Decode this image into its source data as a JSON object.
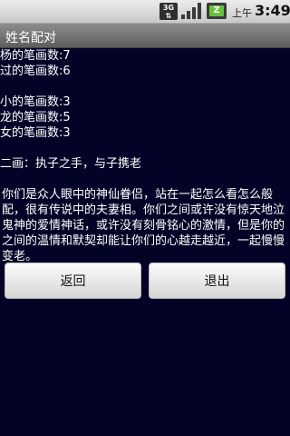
{
  "status_bar": {
    "network_top": "3G",
    "network_bottom": "",
    "ampm": "上午",
    "time": "3:49",
    "icons": [
      "3g-icon",
      "signal-icon",
      "battery-icon"
    ]
  },
  "title_bar": {
    "title": "姓名配对"
  },
  "content": {
    "name1_lines": [
      "杨的笔画数:7",
      "过的笔画数:6"
    ],
    "name2_lines": [
      "小的笔画数:3",
      "龙的笔画数:5",
      "女的笔画数:3"
    ],
    "result_heading": "二画：执子之手，与子携老",
    "description": "你们是众人眼中的神仙眷侣，站在一起怎么看怎么般配，很有传说中的夫妻相。你们之间或许没有惊天地泣鬼神的爱情神话，或许没有刻骨铭心的激情，但是你的之间的温情和默契却能让你们的心越走越近，一起慢慢变老。"
  },
  "buttons": {
    "back_label": "返回",
    "exit_label": "退出"
  },
  "colors": {
    "content_background": "#030327",
    "text": "#ffffff",
    "titlebar": "#6f6f6f",
    "statusbar": "#d9d9d9"
  }
}
